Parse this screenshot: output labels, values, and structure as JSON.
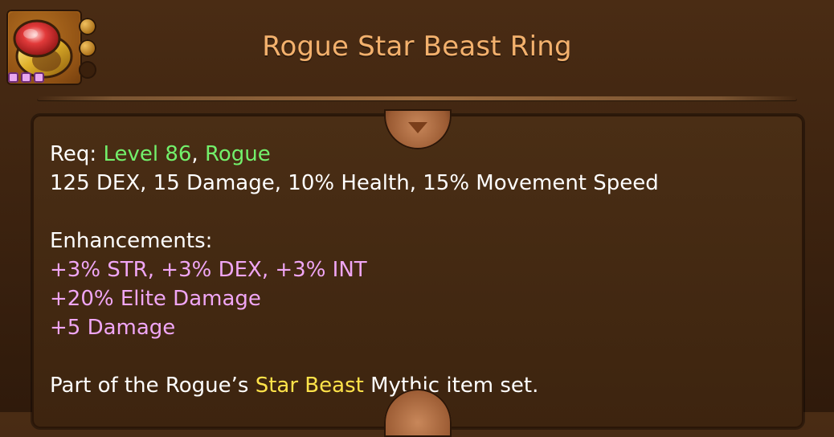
{
  "item": {
    "name": "Rogue Star Beast Ring",
    "requirements": {
      "req_label": "Req:",
      "level": "Level 86",
      "class": "Rogue"
    },
    "base_stats": "125 DEX, 15 Damage, 10% Health, 15% Movement Speed",
    "enhancements_label": "Enhancements:",
    "enhancements": [
      "+3% STR, +3% DEX, +3% INT",
      "+20% Elite Damage",
      "+5 Damage"
    ],
    "set_info": {
      "prefix": "Part of the Rogue’s",
      "set_name": "Star Beast",
      "suffix": "Mythic item set."
    }
  },
  "icons": {
    "item": "ring-icon",
    "gems": [
      "gem-socket-icon",
      "gem-socket-icon",
      "gem-socket-icon"
    ],
    "slots": [
      "rune-slot-icon",
      "rune-slot-icon",
      "empty-slot-icon"
    ]
  },
  "colors": {
    "title": "#f3b16d",
    "requirement": "#73f06b",
    "enhancement": "#f0a6f5",
    "set_name": "#ffe34a"
  }
}
